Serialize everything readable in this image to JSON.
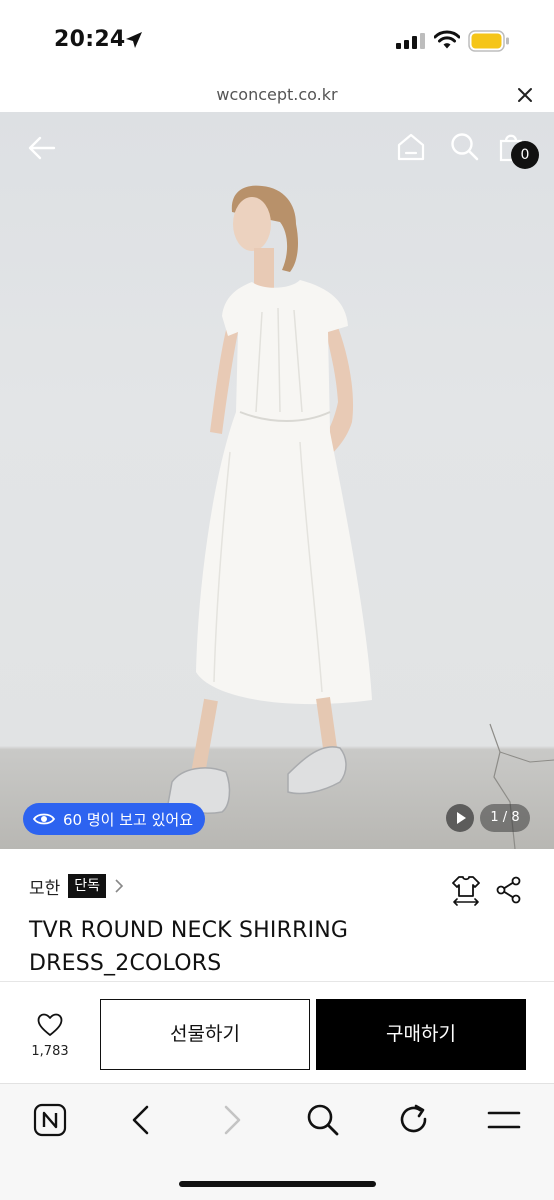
{
  "status_bar": {
    "time": "20:24",
    "icons": [
      "location-arrow-icon",
      "cellular-signal-icon",
      "wifi-icon",
      "battery-icon"
    ],
    "battery_color": "#f5c518"
  },
  "browser": {
    "url": "wconcept.co.kr",
    "close_icon": "close-icon"
  },
  "header": {
    "back_icon": "back-arrow-icon",
    "home_icon": "home-icon",
    "search_icon": "search-icon",
    "cart_icon": "shopping-bag-icon",
    "cart_count": "0"
  },
  "gallery": {
    "viewers_text": "60 명이 보고 있어요",
    "viewers_icon": "eye-icon",
    "play_icon": "play-icon",
    "page_indicator": "1 / 8",
    "accent_color": "#2d63f0"
  },
  "product": {
    "brand": "모한",
    "badge": "단독",
    "title_line1": "TVR ROUND NECK SHIRRING",
    "title_line2": "DRESS_2COLORS",
    "size_icon": "size-guide-icon",
    "share_icon": "share-icon"
  },
  "actions": {
    "like_count": "1,783",
    "gift_label": "선물하기",
    "buy_label": "구매하기"
  },
  "toolbar": {
    "items": [
      "naver-app-icon",
      "back-chevron-icon",
      "forward-chevron-icon",
      "search-icon",
      "reload-icon",
      "menu-icon"
    ]
  }
}
